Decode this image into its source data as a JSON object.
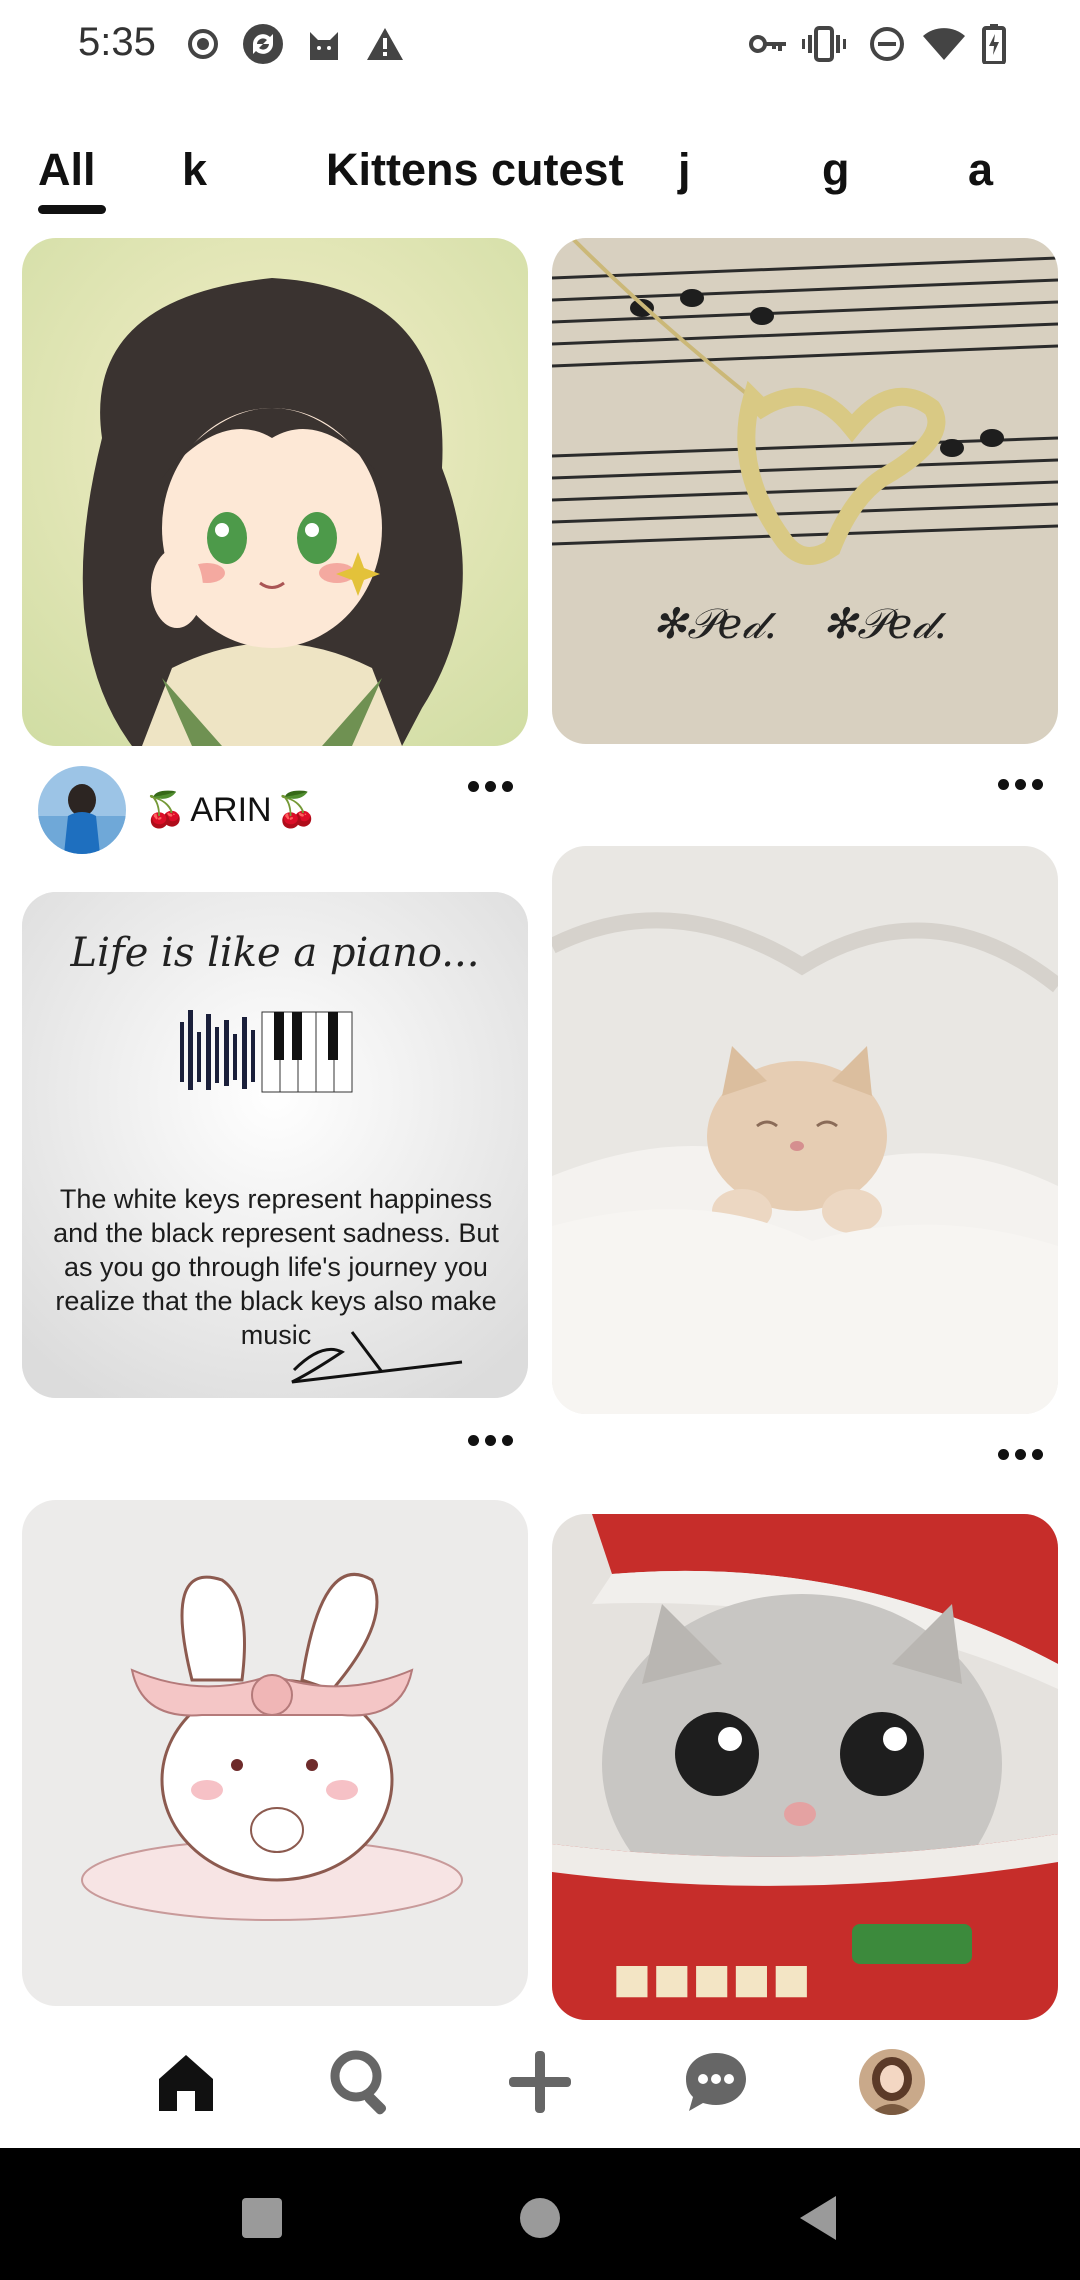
{
  "status_bar": {
    "time": "5:35",
    "icons_left": [
      "record-icon",
      "sync-icon",
      "cat-app-icon",
      "warning-icon"
    ],
    "icons_right": [
      "vpn-key-icon",
      "vibrate-icon",
      "do-not-disturb-icon",
      "wifi-icon",
      "battery-charging-icon"
    ]
  },
  "tabs": [
    {
      "label": "All",
      "selected": true
    },
    {
      "label": "k",
      "selected": false
    },
    {
      "label": "Kittens cutest",
      "selected": false
    },
    {
      "label": "j",
      "selected": false
    },
    {
      "label": "g",
      "selected": false
    },
    {
      "label": "a",
      "selected": false
    }
  ],
  "feed": {
    "pins": [
      {
        "id": "pin-anime-girl",
        "image": "anime girl illustration"
      },
      {
        "id": "pin-necklace",
        "image": "treble clef heart necklace on sheet music"
      },
      {
        "id": "pin-piano-quote",
        "image": "piano quote card"
      },
      {
        "id": "pin-sleeping-kitten",
        "image": "kitten sleeping in white blanket"
      },
      {
        "id": "pin-bunny",
        "image": "bunny sketch"
      },
      {
        "id": "pin-kitten-cup",
        "image": "kitten in noodle cup"
      }
    ],
    "creator": {
      "name": "ARIN",
      "decoration": "🍒"
    },
    "quote_card": {
      "title": "Life is like a piano...",
      "body": "The white keys represent happiness and the black represent sadness. But as you go through life's journey you realize that the black keys also make music"
    }
  },
  "bottom_nav": {
    "items": [
      "home-icon",
      "search-icon",
      "add-icon",
      "messages-icon",
      "profile-avatar"
    ],
    "active": "home-icon"
  },
  "system_nav": [
    "recents-button",
    "home-button",
    "back-button"
  ]
}
